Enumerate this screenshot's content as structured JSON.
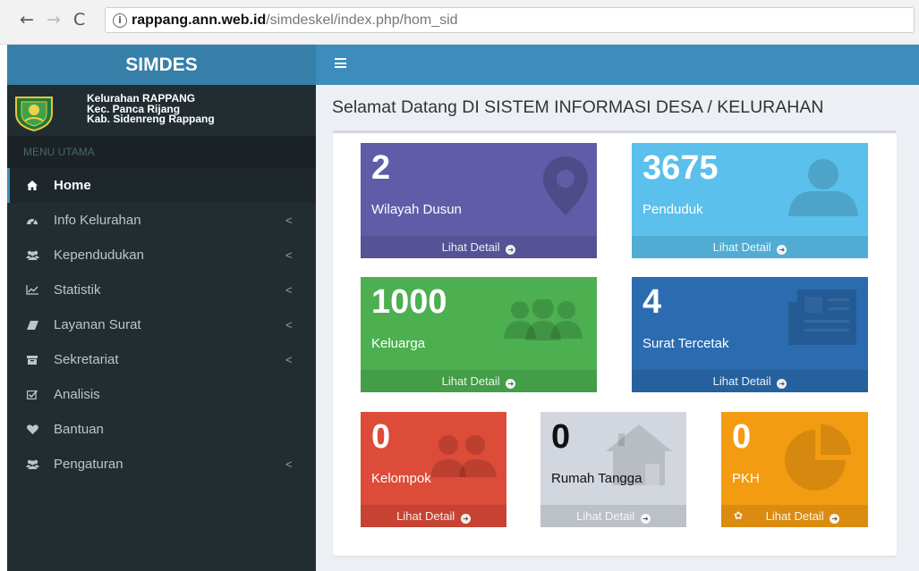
{
  "browser": {
    "back_icon": "←",
    "forward_icon": "→",
    "reload_icon": "C",
    "info_icon": "i",
    "url_host": "rappang.ann.web.id",
    "url_path": "/simdeskel/index.php/hom_sid"
  },
  "app": {
    "title": "SIMDES",
    "org_lines": [
      "Kelurahan RAPPANG",
      "Kec. Panca Rijang",
      "Kab. Sidenreng Rappang"
    ]
  },
  "sidebar": {
    "header": "MENU UTAMA",
    "items": [
      {
        "label": "Home",
        "icon": "home-icon",
        "active": true,
        "caret": ""
      },
      {
        "label": "Info Kelurahan",
        "icon": "dashboard-icon",
        "active": false,
        "caret": "<"
      },
      {
        "label": "Kependudukan",
        "icon": "users-icon",
        "active": false,
        "caret": "<"
      },
      {
        "label": "Statistik",
        "icon": "line-chart-icon",
        "active": false,
        "caret": "<"
      },
      {
        "label": "Layanan Surat",
        "icon": "eraser-icon",
        "active": false,
        "caret": "<"
      },
      {
        "label": "Sekretariat",
        "icon": "archive-icon",
        "active": false,
        "caret": "<"
      },
      {
        "label": "Analisis",
        "icon": "check-square-icon",
        "active": false,
        "caret": ""
      },
      {
        "label": "Bantuan",
        "icon": "heart-icon",
        "active": false,
        "caret": ""
      },
      {
        "label": "Pengaturan",
        "icon": "users-icon",
        "active": false,
        "caret": "<"
      }
    ]
  },
  "main": {
    "welcome": "Selamat Datang DI SISTEM INFORMASI DESA / KELURAHAN",
    "footer_label": "Lihat Detail",
    "footer_arrow": "➜",
    "pkh_footer_icon": "✿",
    "tiles": [
      {
        "number": "2",
        "label": "Wilayah Dusun",
        "color": "#605ca8"
      },
      {
        "number": "3675",
        "label": "Penduduk",
        "color": "#5bc0eb"
      },
      {
        "number": "1000",
        "label": "Keluarga",
        "color": "#4caf50"
      },
      {
        "number": "4",
        "label": "Surat Tercetak",
        "color": "#2b6cb0"
      },
      {
        "number": "0",
        "label": "Kelompok",
        "color": "#dd4b39"
      },
      {
        "number": "0",
        "label": "Rumah Tangga",
        "color": "#d2d6de"
      },
      {
        "number": "0",
        "label": "PKH",
        "color": "#f39c12"
      }
    ]
  }
}
